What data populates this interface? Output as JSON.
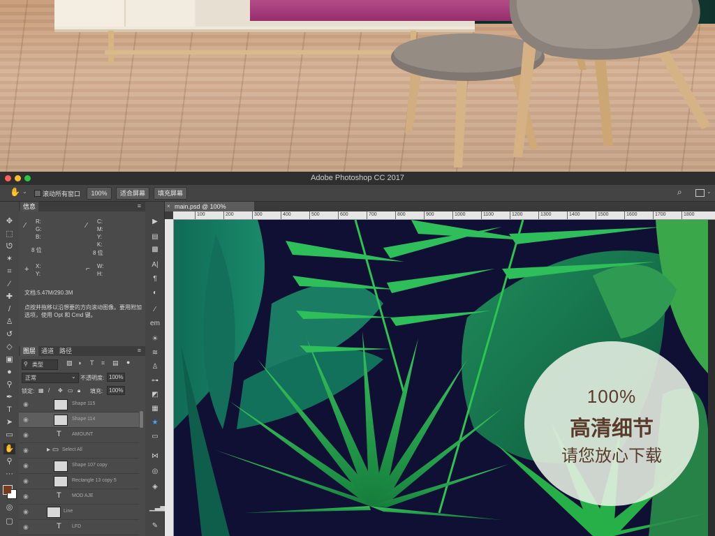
{
  "window": {
    "title": "Adobe Photoshop CC 2017"
  },
  "options_bar": {
    "scroll_all_label": "滚动所有窗口",
    "zoom_label": "100%",
    "fit_screen_label": "适合屏幕",
    "fill_screen_label": "填充屏幕"
  },
  "info_panel": {
    "tab": "信息",
    "r": "R:",
    "g": "G:",
    "b": "B:",
    "bit1": "8 位",
    "c": "C:",
    "m": "M:",
    "y": "Y:",
    "k": "K:",
    "bit2": "8 位",
    "x": "X:",
    "y2": "Y:",
    "w": "W:",
    "h": "H:",
    "doc": "文档:5.47M/290.3M",
    "hint": "点按并拖移以沿想要的方向滚动图像。要用附加选项，使用 Opt 和 Cmd 键。"
  },
  "layers_panel": {
    "tabs": [
      "图层",
      "通道",
      "路径"
    ],
    "filter": "类型",
    "blend": "正常",
    "opacity_label": "不透明度:",
    "opacity": "100%",
    "lock_label": "锁定:",
    "fill_label": "填充:",
    "fill": "100%",
    "layers": [
      "Shape 115",
      "Shape 114",
      "AMOUNT",
      "Select All",
      "Shape 107 copy",
      "Rectangle 13 copy 5",
      "MOD AJE",
      "Line",
      "LFD"
    ]
  },
  "document": {
    "tab": "main.psd @ 100%",
    "ruler": [
      "0",
      "100",
      "200",
      "300",
      "400",
      "500",
      "600",
      "700",
      "800",
      "900",
      "1000",
      "1100",
      "1200",
      "1300",
      "1400",
      "1500",
      "1600",
      "1700",
      "1800"
    ]
  },
  "overlay": {
    "line1": "100%",
    "line2": "高清细节",
    "line3": "请您放心下载"
  },
  "colors": {
    "foreground": "#7a3a1c",
    "background": "#ffffff",
    "canvas_bg": "#101035"
  }
}
